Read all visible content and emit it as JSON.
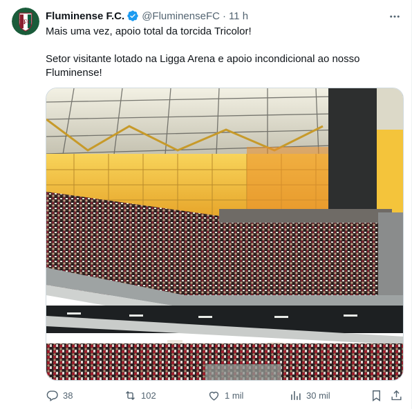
{
  "tweet": {
    "author_name": "Fluminense F.C.",
    "handle": "@FluminenseFC",
    "separator": "·",
    "time": "11 h",
    "text_line1": "Mais uma vez, apoio total da torcida Tricolor!",
    "text_line2": "Setor visitante lotado na Ligga Arena e apoio incondicional ao nosso Fluminense!",
    "media_icon": "stadium-photo",
    "avatar_icon": "fluminense-crest-icon",
    "verified_icon": "verified-badge-icon"
  },
  "actions": {
    "replies": "38",
    "reposts": "102",
    "likes": "1 mil",
    "views": "30 mil"
  },
  "colors": {
    "accent": "#1d9bf0",
    "muted": "#536471",
    "crest_green": "#006341",
    "crest_maroon": "#8b1f2f"
  }
}
